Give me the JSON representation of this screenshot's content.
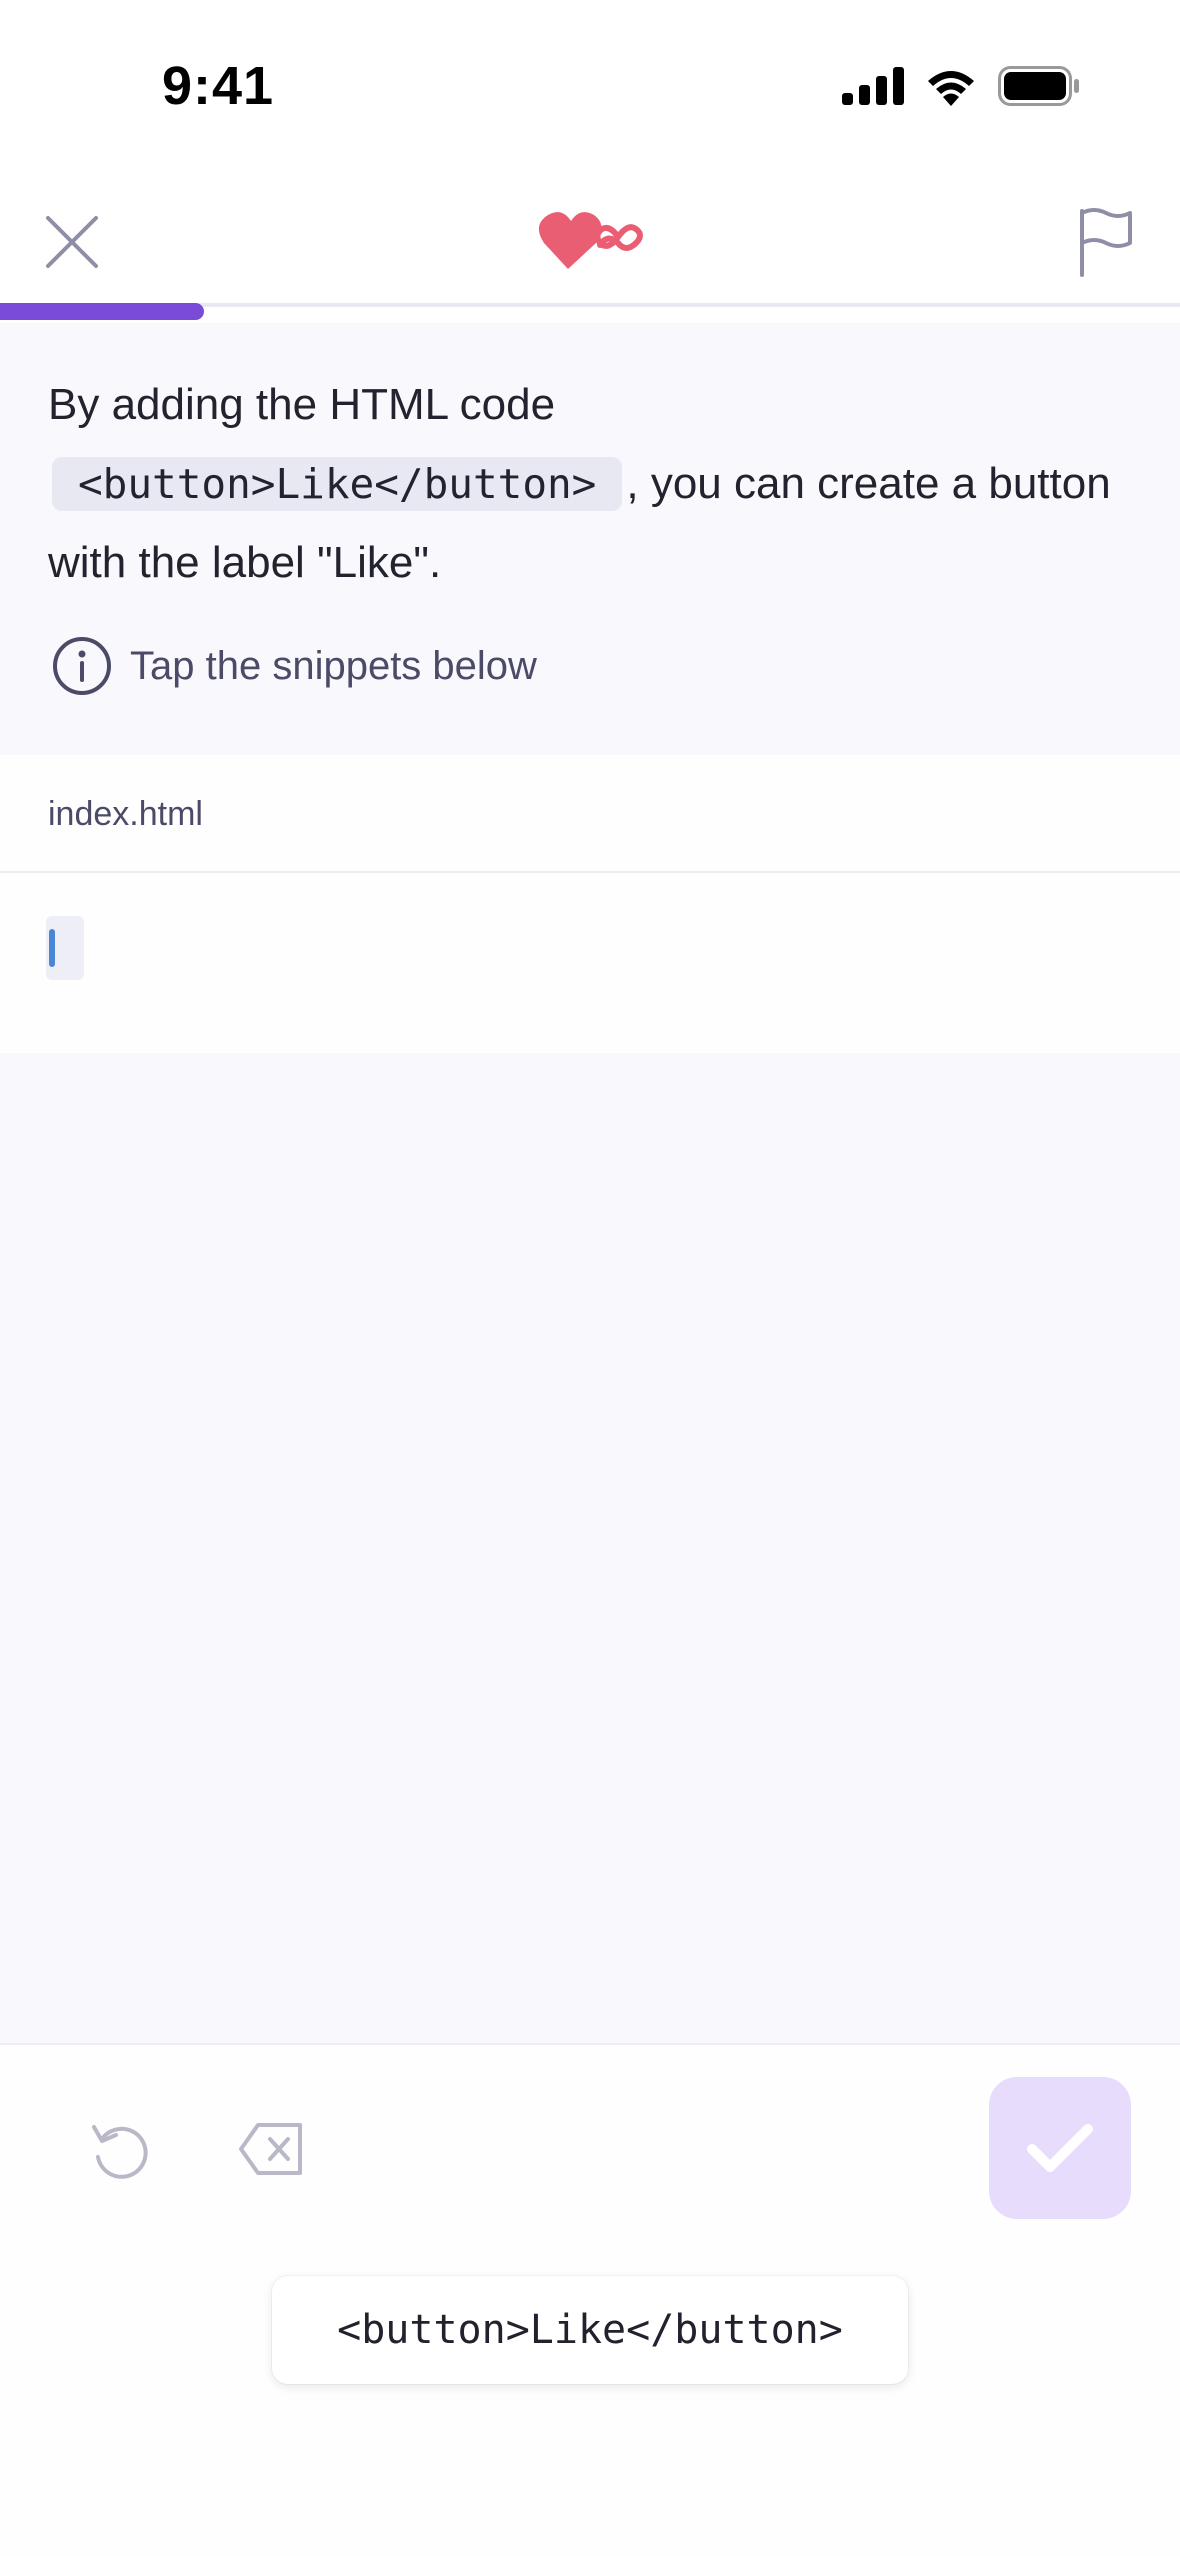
{
  "status_bar": {
    "time": "9:41",
    "icons": [
      "signal-icon",
      "wifi-icon",
      "battery-icon"
    ]
  },
  "top_nav": {
    "close_icon": "close-icon",
    "lives_icon": "heart-infinity-icon",
    "flag_icon": "flag-icon",
    "progress": 0.107,
    "colors": {
      "progress": "#7a4ad8",
      "heart": "#ea5e73"
    }
  },
  "prompt": {
    "text_before": "By adding the HTML code",
    "code": "<button>Like</button>",
    "text_after": ", you can create a button with the label \"Like\".",
    "hint": "Tap the snippets below",
    "hint_icon": "info-icon"
  },
  "editor": {
    "file_name": "index.html",
    "content": ""
  },
  "actions": {
    "undo_icon": "undo-icon",
    "backspace_icon": "backspace-icon",
    "check_icon": "check-icon",
    "check_color": "#e7dcfb"
  },
  "snippets": [
    {
      "code": "<button>Like</button>"
    }
  ]
}
